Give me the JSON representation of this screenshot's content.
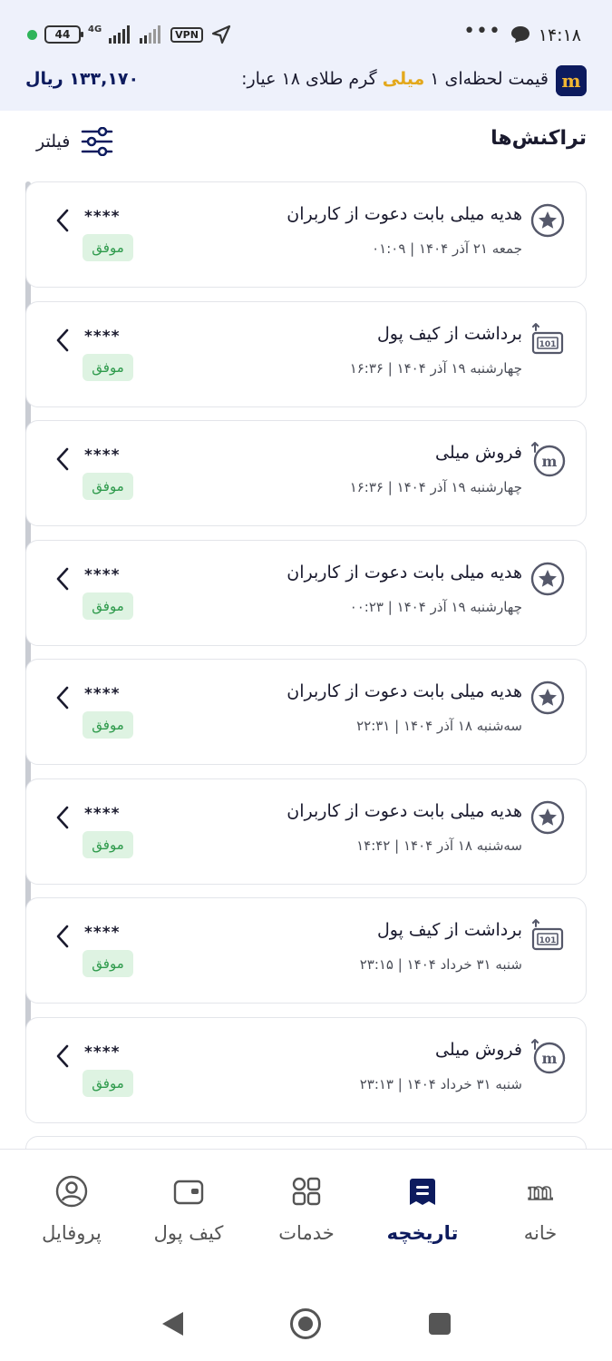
{
  "status_bar": {
    "time": "۱۴:۱۸",
    "battery": "44",
    "network": "4G",
    "vpn_label": "VPN",
    "icons": [
      "dot-icon",
      "battery-icon",
      "signal-icon",
      "vpn-icon",
      "location-arrow-icon",
      "chat-icon"
    ]
  },
  "price_bar": {
    "prefix": "قیمت لحظه‌ای ۱ ",
    "highlight": "میلی",
    "suffix": " گرم طلای ۱۸ عیار:",
    "value": "۱۳۳,۱۷۰ ریال",
    "logo_letter": "m",
    "highlight_color": "#e3a81c"
  },
  "section": {
    "title": "تراکنش‌ها",
    "filter_label": "فیلتر"
  },
  "transactions": [
    {
      "title": "هدیه میلی بابت دعوت از کاربران",
      "date": "جمعه ۲۱ آذر ۱۴۰۴ | ۰۱:۰۹",
      "amount": "****",
      "status": "موفق",
      "icon": "star-icon"
    },
    {
      "title": "برداشت از کیف پول",
      "date": "چهارشنبه ۱۹ آذر ۱۴۰۴ | ۱۶:۳۶",
      "amount": "****",
      "status": "موفق",
      "icon": "cash-withdraw-icon"
    },
    {
      "title": "فروش میلی",
      "date": "چهارشنبه ۱۹ آذر ۱۴۰۴ | ۱۶:۳۶",
      "amount": "****",
      "status": "موفق",
      "icon": "milli-sell-icon"
    },
    {
      "title": "هدیه میلی بابت دعوت از کاربران",
      "date": "چهارشنبه ۱۹ آذر ۱۴۰۴ | ۰۰:۲۳",
      "amount": "****",
      "status": "موفق",
      "icon": "star-icon"
    },
    {
      "title": "هدیه میلی بابت دعوت از کاربران",
      "date": "سه‌شنبه ۱۸ آذر ۱۴۰۴ | ۲۲:۳۱",
      "amount": "****",
      "status": "موفق",
      "icon": "star-icon"
    },
    {
      "title": "هدیه میلی بابت دعوت از کاربران",
      "date": "سه‌شنبه ۱۸ آذر ۱۴۰۴ | ۱۴:۴۲",
      "amount": "****",
      "status": "موفق",
      "icon": "star-icon"
    },
    {
      "title": "برداشت از کیف پول",
      "date": "شنبه ۳۱ خرداد ۱۴۰۴ | ۲۳:۱۵",
      "amount": "****",
      "status": "موفق",
      "icon": "cash-withdraw-icon"
    },
    {
      "title": "فروش میلی",
      "date": "شنبه ۳۱ خرداد ۱۴۰۴ | ۲۳:۱۳",
      "amount": "****",
      "status": "موفق",
      "icon": "milli-sell-icon"
    }
  ],
  "bottom_nav": [
    {
      "label": "خانه",
      "icon": "home-logo-icon",
      "active": false
    },
    {
      "label": "تاریخچه",
      "icon": "history-icon",
      "active": true
    },
    {
      "label": "خدمات",
      "icon": "services-grid-icon",
      "active": false
    },
    {
      "label": "کیف پول",
      "icon": "wallet-icon",
      "active": false
    },
    {
      "label": "پروفایل",
      "icon": "profile-icon",
      "active": false
    }
  ],
  "colors": {
    "brand_navy": "#0d1b5e",
    "success_bg": "#def3e2",
    "success_text": "#2d9a4b",
    "header_bg": "#eef1fb"
  }
}
